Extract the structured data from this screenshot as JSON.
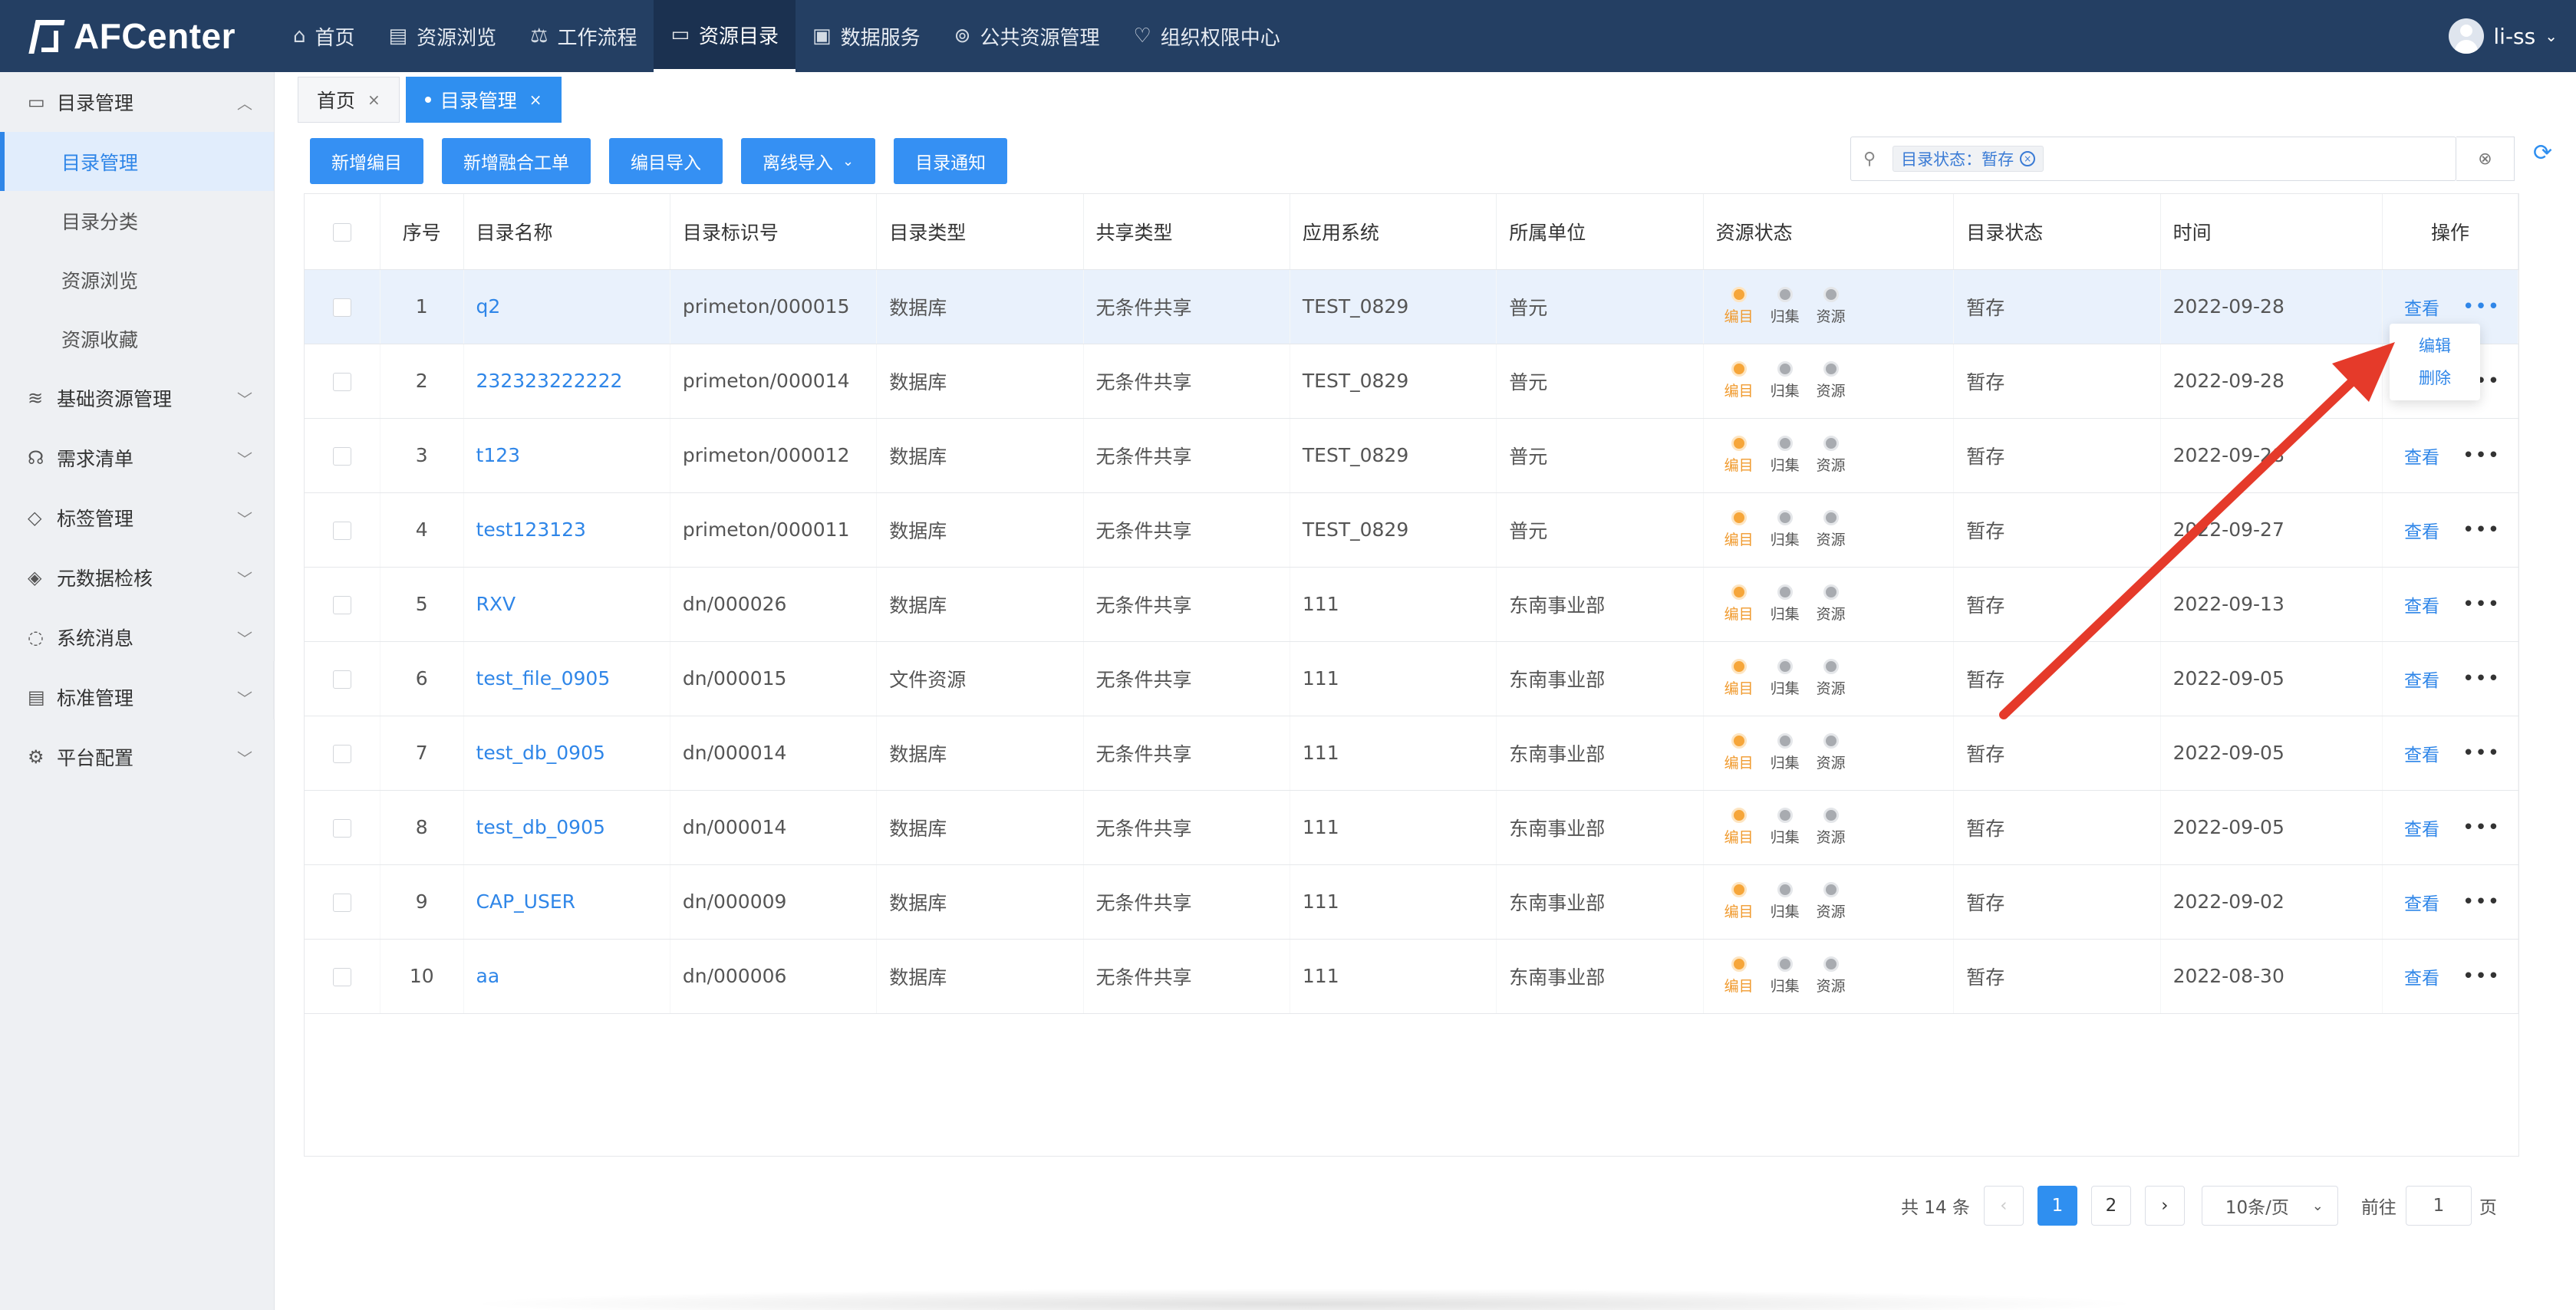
{
  "app": {
    "logo_text": "AFCenter"
  },
  "topnav": [
    {
      "label": "首页",
      "icon": "home-icon"
    },
    {
      "label": "资源浏览",
      "icon": "book-icon"
    },
    {
      "label": "工作流程",
      "icon": "scale-icon"
    },
    {
      "label": "资源目录",
      "icon": "folder-icon",
      "active": true
    },
    {
      "label": "数据服务",
      "icon": "calendar-check-icon"
    },
    {
      "label": "公共资源管理",
      "icon": "gamepad-icon"
    },
    {
      "label": "组织权限中心",
      "icon": "heart-icon"
    }
  ],
  "user": {
    "name": "li-ss"
  },
  "sidebar": {
    "groups": [
      {
        "label": "目录管理",
        "icon": "folder-icon",
        "expanded": true,
        "items": [
          "目录管理",
          "目录分类",
          "资源浏览",
          "资源收藏"
        ]
      },
      {
        "label": "基础资源管理",
        "icon": "layers-icon"
      },
      {
        "label": "需求清单",
        "icon": "headset-icon"
      },
      {
        "label": "标签管理",
        "icon": "tag-icon"
      },
      {
        "label": "元数据检核",
        "icon": "shield-icon"
      },
      {
        "label": "系统消息",
        "icon": "chat-icon"
      },
      {
        "label": "标准管理",
        "icon": "clipboard-icon"
      },
      {
        "label": "平台配置",
        "icon": "gear-icon"
      }
    ],
    "active_item": "目录管理"
  },
  "tabs": [
    {
      "label": "首页"
    },
    {
      "label": "目录管理",
      "active": true
    }
  ],
  "toolbar": {
    "add_catalog": "新增编目",
    "add_merge_order": "新增融合工单",
    "catalog_import": "编目导入",
    "offline_import": "离线导入",
    "catalog_notice": "目录通知"
  },
  "filter": {
    "chip": "目录状态：暂存"
  },
  "table": {
    "headers": [
      "序号",
      "目录名称",
      "目录标识号",
      "目录类型",
      "共享类型",
      "应用系统",
      "所属单位",
      "资源状态",
      "目录状态",
      "时间",
      "操作"
    ],
    "status_labels": [
      "编目",
      "归集",
      "资源"
    ],
    "view_label": "查看",
    "rows": [
      [
        "1",
        "q2",
        "primeton/000015",
        "数据库",
        "无条件共享",
        "TEST_0829",
        "普元",
        "暂存",
        "2022-09-28"
      ],
      [
        "2",
        "232323222222",
        "primeton/000014",
        "数据库",
        "无条件共享",
        "TEST_0829",
        "普元",
        "暂存",
        "2022-09-28"
      ],
      [
        "3",
        "t123",
        "primeton/000012",
        "数据库",
        "无条件共享",
        "TEST_0829",
        "普元",
        "暂存",
        "2022-09-28"
      ],
      [
        "4",
        "test123123",
        "primeton/000011",
        "数据库",
        "无条件共享",
        "TEST_0829",
        "普元",
        "暂存",
        "2022-09-27"
      ],
      [
        "5",
        "RXV",
        "dn/000026",
        "数据库",
        "无条件共享",
        "111",
        "东南事业部",
        "暂存",
        "2022-09-13"
      ],
      [
        "6",
        "test_file_0905",
        "dn/000015",
        "文件资源",
        "无条件共享",
        "111",
        "东南事业部",
        "暂存",
        "2022-09-05"
      ],
      [
        "7",
        "test_db_0905",
        "dn/000014",
        "数据库",
        "无条件共享",
        "111",
        "东南事业部",
        "暂存",
        "2022-09-05"
      ],
      [
        "8",
        "test_db_0905",
        "dn/000014",
        "数据库",
        "无条件共享",
        "111",
        "东南事业部",
        "暂存",
        "2022-09-05"
      ],
      [
        "9",
        "CAP_USER",
        "dn/000009",
        "数据库",
        "无条件共享",
        "111",
        "东南事业部",
        "暂存",
        "2022-09-02"
      ],
      [
        "10",
        "aa",
        "dn/000006",
        "数据库",
        "无条件共享",
        "111",
        "东南事业部",
        "暂存",
        "2022-08-30"
      ]
    ]
  },
  "row_menu": {
    "edit": "编辑",
    "delete": "删除"
  },
  "pagination": {
    "total": "共 14 条",
    "pages": [
      "1",
      "2"
    ],
    "current": "1",
    "page_size": "10条/页",
    "goto_label": "前往",
    "goto_value": "1",
    "goto_suffix": "页"
  },
  "colors": {
    "accent": "#2f8ff0",
    "topbar": "#243f63",
    "annotation_arrow": "#e53a2a"
  }
}
